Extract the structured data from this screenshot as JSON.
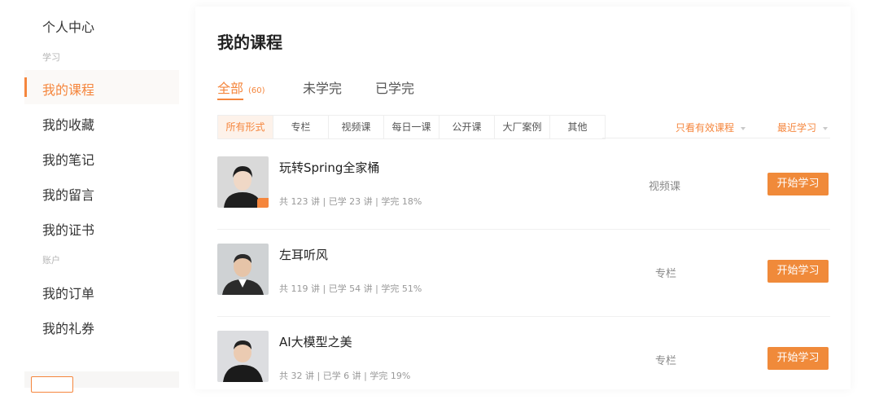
{
  "sidebar": {
    "top_item": "个人中心",
    "group_learning": "学习",
    "items_learning": [
      "我的课程",
      "我的收藏",
      "我的笔记",
      "我的留言",
      "我的证书"
    ],
    "group_account": "账户",
    "items_account": [
      "我的订单",
      "我的礼券"
    ],
    "active_item": "我的课程"
  },
  "main": {
    "title": "我的课程",
    "tabs": [
      {
        "label": "全部",
        "count": "(60)"
      },
      {
        "label": "未学完"
      },
      {
        "label": "已学完"
      }
    ],
    "filters": [
      "所有形式",
      "专栏",
      "视频课",
      "每日一课",
      "公开课",
      "大厂案例",
      "其他"
    ],
    "dropdown_valid": "只看有效课程",
    "dropdown_sort": "最近学习",
    "courses": [
      {
        "title": "玩转Spring全家桶",
        "stats": "共 123 讲 | 已学 23 讲 | 学完 18%",
        "type": "视频课",
        "button": "开始学习",
        "has_video_badge": true
      },
      {
        "title": "左耳听风",
        "stats": "共 119 讲 | 已学 54 讲 | 学完 51%",
        "type": "专栏",
        "button": "开始学习"
      },
      {
        "title": "AI大模型之美",
        "stats": "共 32 讲 | 已学 6 讲 | 学完 19%",
        "type": "专栏",
        "button": "开始学习"
      }
    ]
  },
  "colors": {
    "accent": "#f5863d",
    "button": "#f08a3a",
    "active_bg": "#fdf2ea"
  }
}
